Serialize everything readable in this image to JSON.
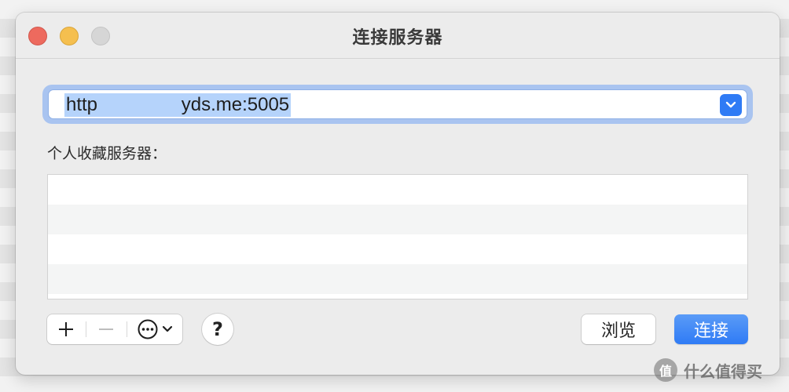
{
  "window": {
    "title": "连接服务器"
  },
  "server_address": {
    "value": "http                yds.me:5005"
  },
  "favorites": {
    "label": "个人收藏服务器：",
    "rows": [
      "",
      "",
      "",
      ""
    ]
  },
  "buttons": {
    "add": "+",
    "remove": "—",
    "help": "?",
    "browse": "浏览",
    "connect": "连接"
  },
  "icons": {
    "dropdown": "chevron-down-icon",
    "more": "ellipsis-circle-icon"
  },
  "colors": {
    "accent": "#2f7bf5",
    "close": "#ed6a5e",
    "minimize": "#f5bf4f"
  },
  "watermark": {
    "logo": "值",
    "text": "什么值得买"
  }
}
